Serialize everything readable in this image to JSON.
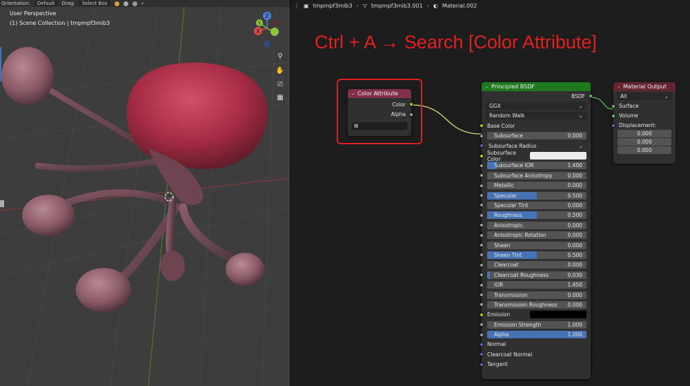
{
  "viewport": {
    "toolbar": {
      "orientation_label": "Orientation:",
      "orientation_value": "Default",
      "drag_label": "Drag:",
      "drag_value": "Select Box"
    },
    "perspective": "User Perspective",
    "collection": "(1) Scene Collection | tmpmpf3mib3",
    "gizmo": {
      "z": "Z",
      "y": "Y",
      "x": "X"
    },
    "tools": [
      "zoom-icon",
      "hand-icon",
      "camera-icon",
      "grid-icon"
    ]
  },
  "editor": {
    "breadcrumb": [
      "tmpmpf3mib3",
      "tmpmpf3mib3.001",
      "Material.002"
    ],
    "annotation": "Ctrl + A  →  Search [Color Attribute]",
    "color_attribute": {
      "title": "Color Attribute",
      "outputs": [
        "Color",
        "Alpha"
      ]
    },
    "principled": {
      "title": "Principled BSDF",
      "output": "BSDF",
      "distribution": "GGX",
      "subsurface_method": "Random Walk",
      "base_color_label": "Base Color",
      "subsurface": {
        "label": "Subsurface",
        "value": "0.000"
      },
      "subsurface_radius": "Subsurface Radius",
      "subsurface_color": "Subsurface Color",
      "fields": [
        {
          "label": "Subsurface IOR",
          "value": "1.400",
          "fill": 0.1
        },
        {
          "label": "Subsurface Anisotropy",
          "value": "0.000",
          "fill": 0
        },
        {
          "label": "Metallic",
          "value": "0.000",
          "fill": 0
        },
        {
          "label": "Specular",
          "value": "0.500",
          "fill": 0.5
        },
        {
          "label": "Specular Tint",
          "value": "0.000",
          "fill": 0
        },
        {
          "label": "Roughness",
          "value": "0.500",
          "fill": 0.5
        },
        {
          "label": "Anisotropic",
          "value": "0.000",
          "fill": 0
        },
        {
          "label": "Anisotropic Rotation",
          "value": "0.000",
          "fill": 0
        },
        {
          "label": "Sheen",
          "value": "0.000",
          "fill": 0
        },
        {
          "label": "Sheen Tint",
          "value": "0.500",
          "fill": 0.5
        },
        {
          "label": "Clearcoat",
          "value": "0.000",
          "fill": 0
        },
        {
          "label": "Clearcoat Roughness",
          "value": "0.030",
          "fill": 0.03
        },
        {
          "label": "IOR",
          "value": "1.450",
          "fill": 0
        },
        {
          "label": "Transmission",
          "value": "0.000",
          "fill": 0
        },
        {
          "label": "Transmission Roughness",
          "value": "0.000",
          "fill": 0
        }
      ],
      "emission_label": "Emission",
      "emission_strength": {
        "label": "Emission Strength",
        "value": "1.000"
      },
      "alpha": {
        "label": "Alpha",
        "value": "1.000",
        "fill": 1
      },
      "normal": "Normal",
      "clearcoat_normal": "Clearcoat Normal",
      "tangent": "Tangent"
    },
    "material_output": {
      "title": "Material Output",
      "target": "All",
      "inputs": [
        "Surface",
        "Volume"
      ],
      "displacement_label": "Displacement:",
      "displacement": [
        "0.000",
        "0.000",
        "0.000"
      ]
    },
    "colors": {
      "shader_header": "#1f7a1f",
      "input_header": "#83314a",
      "output_header": "#652530",
      "accent": "#4772b3",
      "annotation": "#e2211f"
    }
  }
}
